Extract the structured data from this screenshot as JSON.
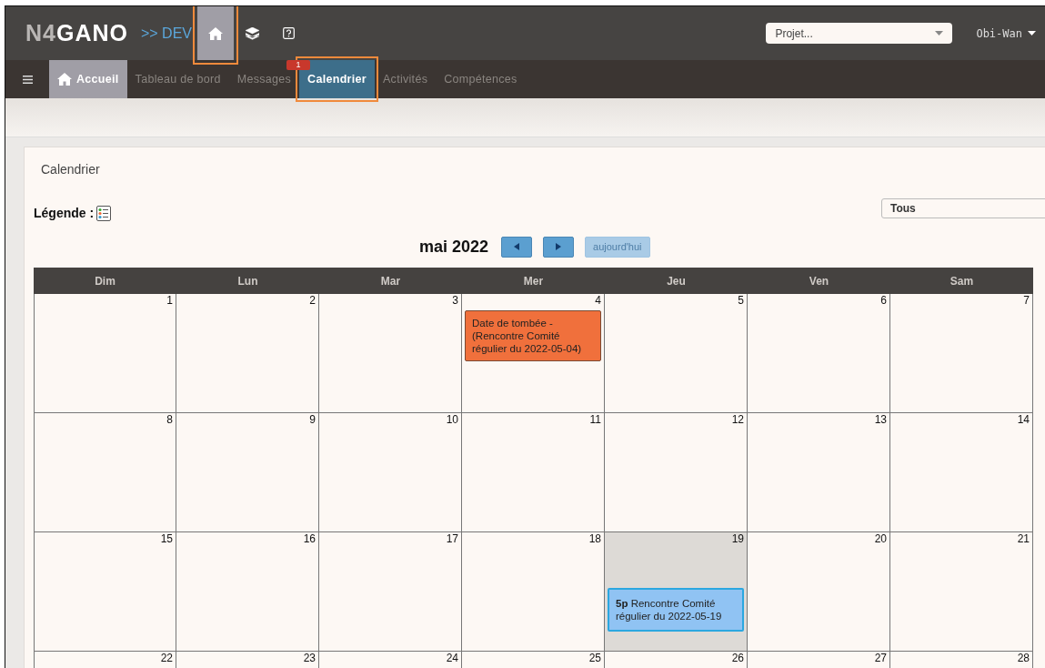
{
  "topbar": {
    "logo_prefix": "N4",
    "logo_main": "GANO",
    "environment": ">> DEV",
    "tools": [
      {
        "kind": "home",
        "selected": true,
        "highlighted": true
      },
      {
        "kind": "layers",
        "selected": false,
        "highlighted": false
      },
      {
        "kind": "help",
        "selected": false,
        "highlighted": false
      }
    ],
    "project_select": {
      "placeholder": "Projet..."
    },
    "user": "Obi-Wan"
  },
  "nav": {
    "tabs": [
      {
        "label": "Accueil",
        "kind": "home",
        "selected": false,
        "highlighted": false
      },
      {
        "label": "Tableau de bord",
        "kind": "plain",
        "selected": false,
        "highlighted": false
      },
      {
        "label": "Messages",
        "kind": "plain",
        "selected": false,
        "highlighted": false,
        "badge": "1"
      },
      {
        "label": "Calendrier",
        "kind": "plain",
        "selected": true,
        "highlighted": true
      },
      {
        "label": "Activités",
        "kind": "plain",
        "selected": false,
        "highlighted": false
      },
      {
        "label": "Compétences",
        "kind": "plain",
        "selected": false,
        "highlighted": false
      }
    ]
  },
  "panel": {
    "title": "Calendrier",
    "legend_label": "Légende :",
    "filter": {
      "value": "Tous"
    },
    "month": "mai 2022",
    "today_button": {
      "label": "aujourd'hui",
      "disabled": true
    },
    "weekdays": [
      "Dim",
      "Lun",
      "Mar",
      "Mer",
      "Jeu",
      "Ven",
      "Sam"
    ],
    "weeks": [
      [
        {
          "day": "1"
        },
        {
          "day": "2"
        },
        {
          "day": "3"
        },
        {
          "day": "4",
          "events": [
            {
              "kind": "deadline",
              "color": "#f0703c",
              "title": "Date de tombée - (Rencontre Comité régulier du 2022-05-04)"
            }
          ]
        },
        {
          "day": "5"
        },
        {
          "day": "6"
        },
        {
          "day": "7"
        }
      ],
      [
        {
          "day": "8"
        },
        {
          "day": "9"
        },
        {
          "day": "10"
        },
        {
          "day": "11"
        },
        {
          "day": "12"
        },
        {
          "day": "13"
        },
        {
          "day": "14"
        }
      ],
      [
        {
          "day": "15"
        },
        {
          "day": "16"
        },
        {
          "day": "17"
        },
        {
          "day": "18"
        },
        {
          "day": "19",
          "today": true,
          "events": [
            {
              "kind": "meeting",
              "color": "#90c3f3",
              "time": "5p",
              "title": "Rencontre Comité régulier du 2022-05-19"
            }
          ]
        },
        {
          "day": "20"
        },
        {
          "day": "21"
        }
      ],
      [
        {
          "day": "22"
        },
        {
          "day": "23"
        },
        {
          "day": "24"
        },
        {
          "day": "25"
        },
        {
          "day": "26"
        },
        {
          "day": "27"
        },
        {
          "day": "28"
        }
      ]
    ]
  }
}
